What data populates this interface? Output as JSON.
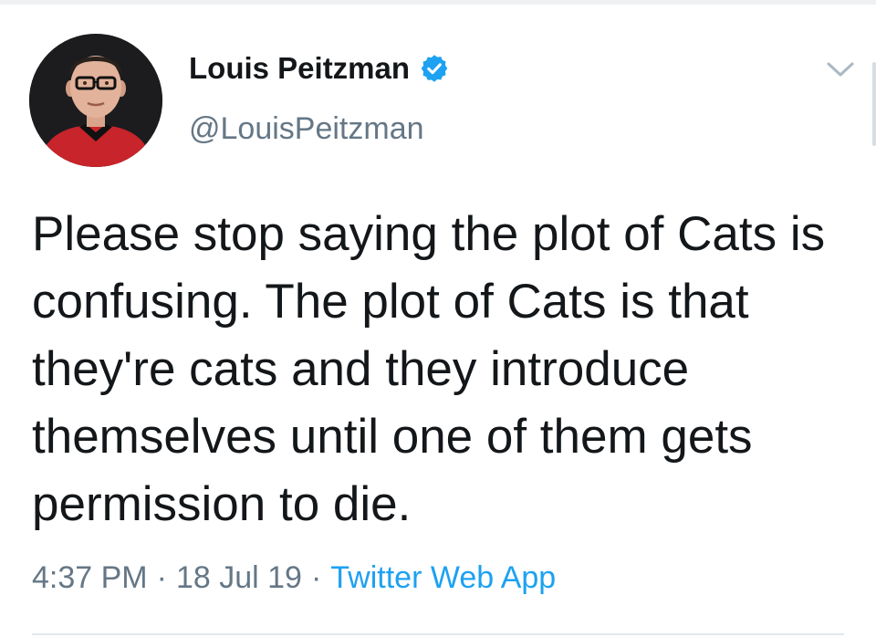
{
  "tweet": {
    "author": {
      "name": "Louis Peitzman",
      "handle": "@LouisPeitzman",
      "verified": true,
      "avatar_icon": "user-avatar"
    },
    "text": "Please stop saying the plot of Cats is confusing. The plot of Cats is that they're cats and they introduce themselves until one of them gets permission to die.",
    "time": "4:37 PM",
    "date": "18 Jul 19",
    "separator": "·",
    "source": "Twitter Web App"
  },
  "icons": {
    "verified": "verified-badge-icon",
    "menu": "chevron-down-icon"
  },
  "colors": {
    "text": "#14171a",
    "secondary": "#657786",
    "accent": "#1da1f2",
    "divider": "#e1e8ed"
  }
}
